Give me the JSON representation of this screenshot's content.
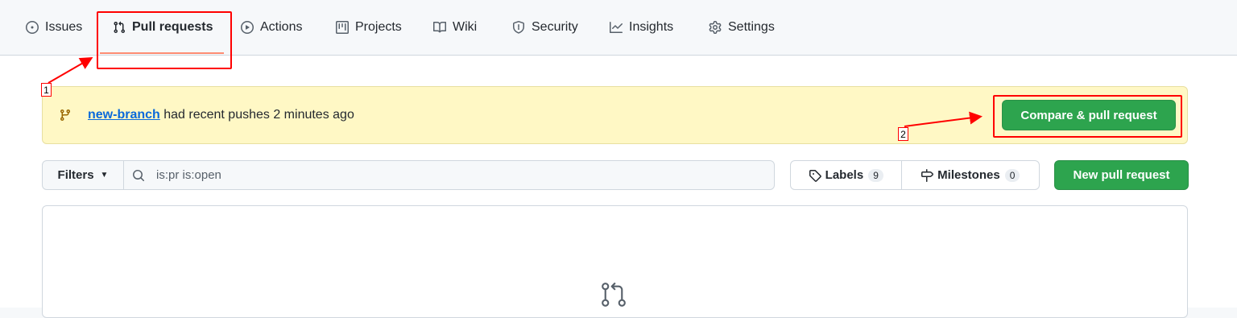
{
  "nav": {
    "tabs": [
      {
        "label": "Issues",
        "icon": "issue-opened-icon"
      },
      {
        "label": "Pull requests",
        "icon": "git-pull-request-icon",
        "active": true
      },
      {
        "label": "Actions",
        "icon": "play-icon"
      },
      {
        "label": "Projects",
        "icon": "table-icon"
      },
      {
        "label": "Wiki",
        "icon": "book-icon"
      },
      {
        "label": "Security",
        "icon": "shield-icon"
      },
      {
        "label": "Insights",
        "icon": "graph-icon"
      },
      {
        "label": "Settings",
        "icon": "gear-icon"
      }
    ]
  },
  "banner": {
    "branch": "new-branch",
    "message": " had recent pushes 2 minutes ago",
    "compare_button": "Compare & pull request"
  },
  "filters": {
    "button_label": "Filters",
    "search_value": "is:pr is:open"
  },
  "labels": {
    "label": "Labels",
    "count": "9"
  },
  "milestones": {
    "label": "Milestones",
    "count": "0"
  },
  "new_pr_button": "New pull request",
  "annotations": {
    "one": "1",
    "two": "2"
  },
  "colors": {
    "accent_green": "#2da44e",
    "banner_bg": "#fff8c5",
    "link_blue": "#0969da",
    "active_tab_underline": "#fd8c73",
    "annotation_red": "#ff0000"
  }
}
